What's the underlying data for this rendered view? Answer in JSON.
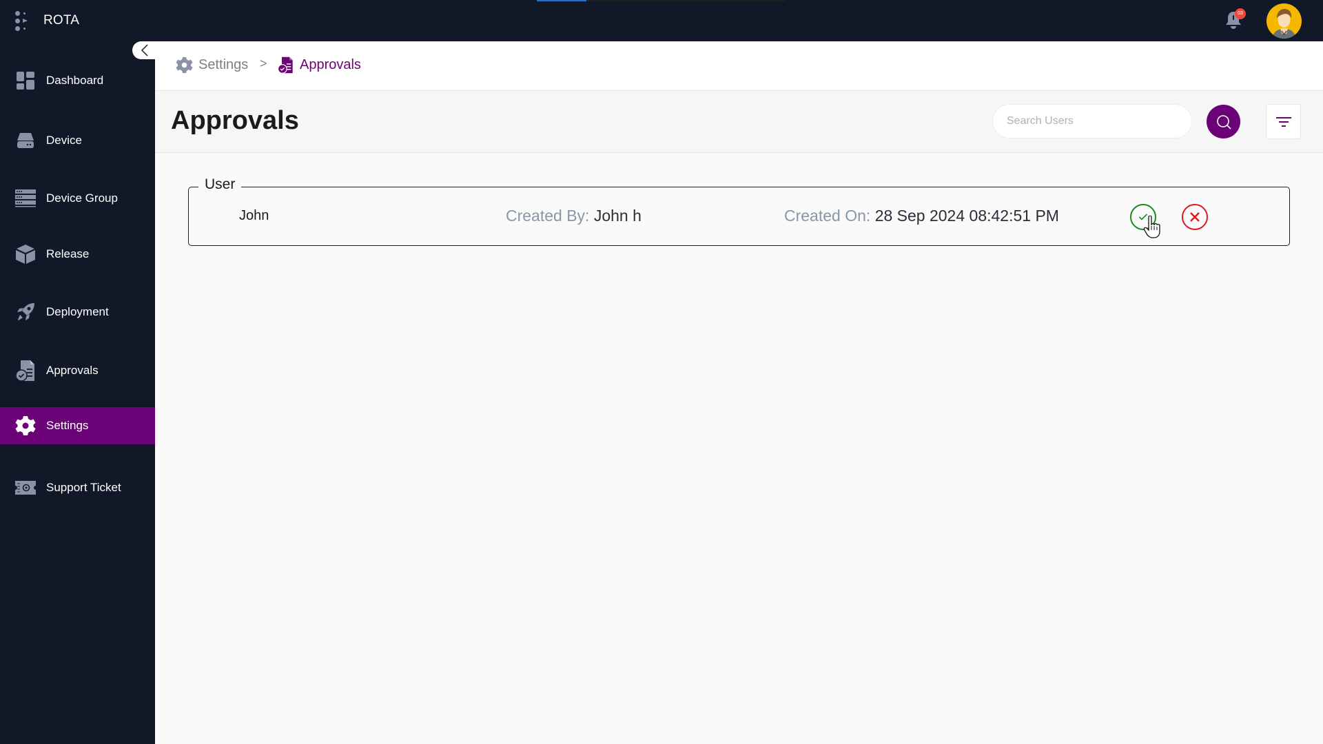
{
  "app": {
    "title": "ROTA",
    "loading_progress_percent": 20,
    "notifications_count": "03"
  },
  "colors": {
    "brand_purple": "#6c0277",
    "sidebar_bg": "#111827",
    "approve_green": "#1a8a1a",
    "reject_red": "#e0141e",
    "progress_blue": "#1677e0",
    "badge_red": "#f2463a"
  },
  "sidebar": {
    "collapse_icon": "chevron-left-icon",
    "items": [
      {
        "label": "Dashboard",
        "icon": "dashboard-icon",
        "active": false
      },
      {
        "label": "Device",
        "icon": "hard-drive-icon",
        "active": false
      },
      {
        "label": "Device Group",
        "icon": "server-rack-icon",
        "active": false
      },
      {
        "label": "Release",
        "icon": "cube-icon",
        "active": false
      },
      {
        "label": "Deployment",
        "icon": "rocket-icon",
        "active": false
      },
      {
        "label": "Approvals",
        "icon": "document-check-icon",
        "active": false
      },
      {
        "label": "Settings",
        "icon": "gear-icon",
        "active": true
      },
      {
        "label": "Support Ticket",
        "icon": "ticket-icon",
        "active": false
      }
    ]
  },
  "breadcrumb": {
    "items": [
      {
        "label": "Settings",
        "icon": "gear-icon"
      },
      {
        "label": "Approvals",
        "icon": "document-check-icon"
      }
    ],
    "separator": ">"
  },
  "header": {
    "title": "Approvals",
    "search": {
      "placeholder": "Search Users",
      "value": ""
    },
    "search_button_icon": "search-icon",
    "filter_button_icon": "filter-icon"
  },
  "approvals": [
    {
      "group": "User",
      "name": "John",
      "created_by_label": "Created By:",
      "created_by": "John h",
      "created_on_label": "Created On:",
      "created_on": "28 Sep 2024 08:42:51 PM",
      "approve_icon": "check-circle-icon",
      "reject_icon": "x-circle-icon"
    }
  ]
}
